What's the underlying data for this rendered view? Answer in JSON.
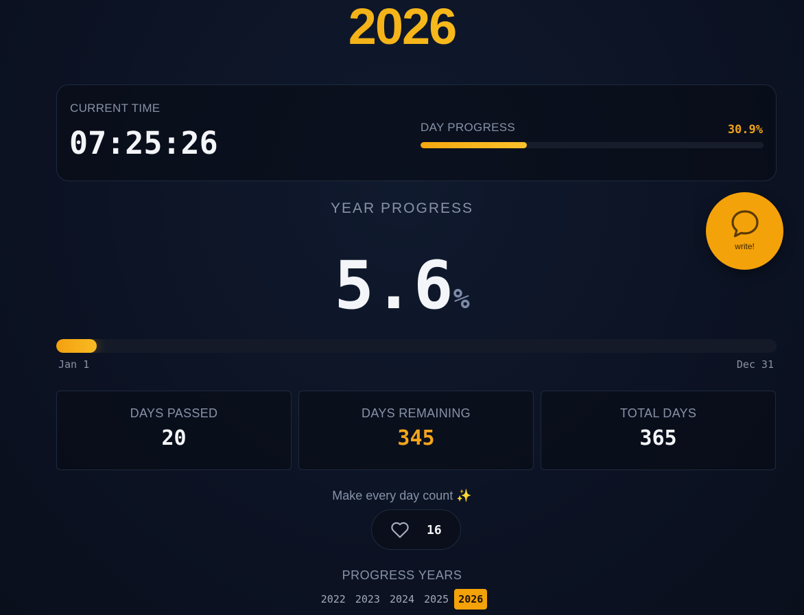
{
  "header": {
    "year": "2026"
  },
  "time_card": {
    "current_time_label": "CURRENT TIME",
    "current_time": "07:25:26",
    "day_progress_label": "DAY PROGRESS",
    "day_progress_pct_text": "30.9%",
    "day_progress_fraction": 0.309
  },
  "year_progress": {
    "label": "YEAR PROGRESS",
    "value": "5.6",
    "unit": "%",
    "fraction": 0.056,
    "start_label": "Jan 1",
    "end_label": "Dec 31"
  },
  "fab": {
    "label": "write!",
    "icon": "chat-bubble-icon",
    "color": "#f4a20a"
  },
  "stats": [
    {
      "label": "DAYS PASSED",
      "value": "20"
    },
    {
      "label": "DAYS REMAINING",
      "value": "345",
      "accent": true
    },
    {
      "label": "TOTAL DAYS",
      "value": "365"
    }
  ],
  "tagline": "Make every day count ✨",
  "like": {
    "icon": "heart-icon",
    "count": "16"
  },
  "progress_years": {
    "label": "PROGRESS YEARS",
    "years": [
      "2022",
      "2023",
      "2024",
      "2025",
      "2026"
    ],
    "active": "2026"
  },
  "colors": {
    "accent": "#f4a20a",
    "background": "#0c1324"
  }
}
